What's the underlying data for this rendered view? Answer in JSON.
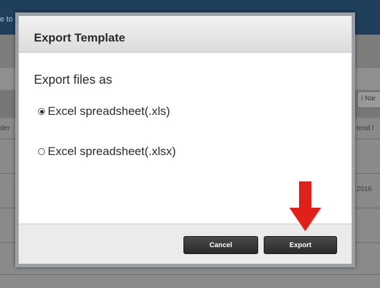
{
  "background": {
    "topbar_text": "e to",
    "left_fragment": "der",
    "right_fragment_1": "l Nar",
    "right_fragment_2": "tend l",
    "right_fragment_3": "2016"
  },
  "dialog": {
    "title": "Export Template",
    "prompt": "Export files as",
    "options": [
      {
        "label": "Excel spreadsheet(.xls)",
        "selected": true
      },
      {
        "label": "Excel spreadsheet(.xlsx)",
        "selected": false
      }
    ],
    "cancel_label": "Cancel",
    "export_label": "Export"
  },
  "annotation": {
    "arrow_color": "#e0201b",
    "arrow_icon": "down-arrow-icon"
  }
}
